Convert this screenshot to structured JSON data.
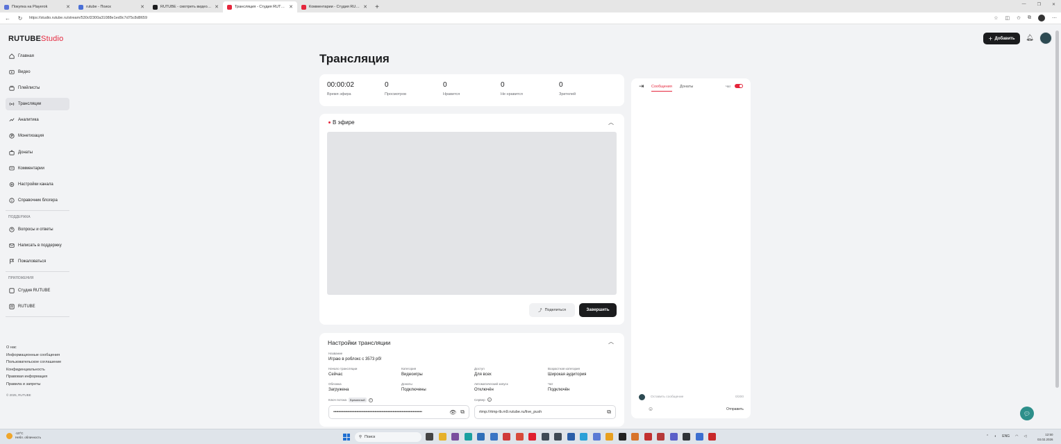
{
  "browser": {
    "tabs": [
      {
        "label": "Покупка на Plaуerok",
        "active": false,
        "color": "#5b74d8"
      },
      {
        "label": "rutube - Поиск",
        "active": false,
        "color": "#4a6fd6"
      },
      {
        "label": "RUTUBE - смотреть видео онлайн",
        "active": false,
        "color": "#1b1c1e"
      },
      {
        "label": "Трансляция - Студия RUTUBE",
        "active": true,
        "color": "#e5263c"
      },
      {
        "label": "Комментарии - Студия RUTUBE",
        "active": false,
        "color": "#e5263c"
      }
    ],
    "url": "https://studio.rutube.ru/stream/530cf2300a31088e1ed9c7d75c8d8659"
  },
  "logo": {
    "brand": "RUTUBE",
    "product": "Studio"
  },
  "sidebar": {
    "main_items": [
      {
        "label": "Главная",
        "icon": "home-icon",
        "active": false
      },
      {
        "label": "Видео",
        "icon": "video-icon",
        "active": false
      },
      {
        "label": "Плейлисты",
        "icon": "playlist-icon",
        "active": false
      },
      {
        "label": "Трансляции",
        "icon": "broadcast-icon",
        "active": true
      },
      {
        "label": "Аналитика",
        "icon": "analytics-icon",
        "active": false
      },
      {
        "label": "Монетизация",
        "icon": "monetization-icon",
        "active": false
      },
      {
        "label": "Донаты",
        "icon": "donate-icon",
        "active": false
      },
      {
        "label": "Комментарии",
        "icon": "comments-icon",
        "active": false
      },
      {
        "label": "Настройки канала",
        "icon": "settings-icon",
        "active": false
      },
      {
        "label": "Справочник блогера",
        "icon": "info-icon",
        "active": false
      }
    ],
    "support_label": "ПОДДЕРЖКА",
    "support_items": [
      {
        "label": "Вопросы и ответы",
        "icon": "help-icon"
      },
      {
        "label": "Написать в поддержку",
        "icon": "mail-icon"
      },
      {
        "label": "Пожаловаться",
        "icon": "flag-icon"
      }
    ],
    "apps_label": "ПРИЛОЖЕНИЯ",
    "apps_items": [
      {
        "label": "Студия RUTUBE",
        "icon": "studio-app-icon"
      },
      {
        "label": "RUTUBE",
        "icon": "rutube-app-icon"
      }
    ],
    "footer_links": [
      "О нас",
      "Информационные сообщения",
      "Пользовательское соглашение",
      "Конфиденциальность",
      "Правовая информация",
      "Правила и запреты"
    ],
    "copyright": "© 2025, RUTUBE"
  },
  "header": {
    "add_label": "Добавить"
  },
  "page": {
    "title": "Трансляция"
  },
  "stats": [
    {
      "value": "00:00:02",
      "label": "Время эфира"
    },
    {
      "value": "0",
      "label": "Просмотров"
    },
    {
      "value": "0",
      "label": "Нравится"
    },
    {
      "value": "0",
      "label": "Не нравится"
    },
    {
      "value": "0",
      "label": "Зрителей"
    }
  ],
  "live": {
    "title": "В эфире",
    "share_label": "Поделиться",
    "end_label": "Завершить"
  },
  "settings": {
    "title": "Настройки трансляции",
    "name_label": "Название",
    "name_value": "Играю в роблокс с 3573 pб!",
    "fields": [
      {
        "label": "Начало трансляции",
        "value": "Сейчас"
      },
      {
        "label": "Категория",
        "value": "Видеоигры"
      },
      {
        "label": "Доступ",
        "value": "Для всех"
      },
      {
        "label": "Возрастная категория",
        "value": "Широкая аудитория"
      },
      {
        "label": "Обложка",
        "value": "Загружена"
      },
      {
        "label": "Донаты",
        "value": "Подключены"
      },
      {
        "label": "Автоматический запуск",
        "value": "Отключён"
      },
      {
        "label": "Чат",
        "value": "Подключён"
      }
    ],
    "key_label": "Ключ потока",
    "key_badge": "Временный",
    "key_value": "••••••••••••••••••••••••••••••••••••••••••••••••••••••••••••••••••••••••••••••••••••••••",
    "server_label": "Сервер",
    "server_value": "rtmp://rtmp-lb.m9.rutube.ru/live_push"
  },
  "chat": {
    "tab_messages": "Сообщения",
    "tab_donates": "Донаты",
    "toggle_label": "Чат",
    "placeholder": "Оставить сообщение",
    "counter": "0/200",
    "send_label": "Отправить"
  },
  "taskbar": {
    "temperature": "-10°C",
    "weather": "Небл. облачность",
    "search_label": "Поиск",
    "lang": "ENG",
    "time": "12:50",
    "date": "03.02.2026"
  }
}
